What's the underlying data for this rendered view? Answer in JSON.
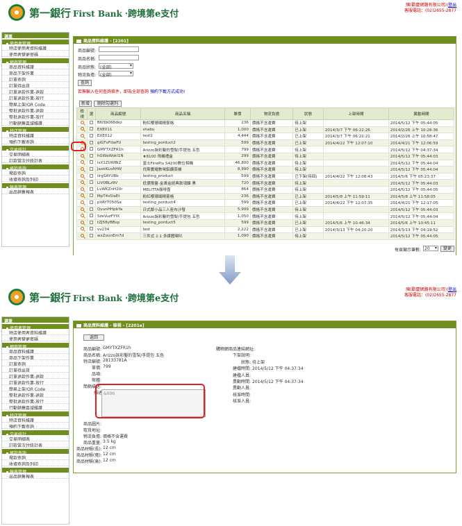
{
  "header": {
    "bank_name": "第一銀行",
    "bank_name_en": "First Bank",
    "service": "‧跨境第e支付",
    "merchant": "陳(歡慶網路有限公司)",
    "logout": "登出",
    "phone": "客服電話：(02)2655-2877"
  },
  "sidebar": {
    "top": "選單",
    "groups": [
      {
        "label": "使用者管理",
        "items": [
          "特店使用者資料維護",
          "使用者變更密碼"
        ]
      },
      {
        "label": "網商管理",
        "items": [
          "商品資料維護",
          "商品下架作業",
          "訂單查詢",
          "訂單待出貨",
          "訂單退款作業-退款",
          "訂單退款作業-放行",
          "簡易上架/QR Code",
          "整批退款作業-退款",
          "整批退款作業-放行",
          "行動銷售區域維護"
        ]
      },
      {
        "label": "特店管理",
        "items": [
          "特店資料維護",
          "預約下載查詢"
        ]
      },
      {
        "label": "交易統計",
        "items": [
          "交易明細表",
          "訂款當次付統計表"
        ]
      },
      {
        "label": "帳款查詢",
        "items": [
          "撥款查詢",
          "收據查詢及列印"
        ]
      },
      {
        "label": "報表管理",
        "items": [
          "出品銷售報表"
        ]
      }
    ]
  },
  "list": {
    "title": "商品資料維護 - [2201]",
    "form": {
      "code_label": "商品編號:",
      "name_label": "商品名稱:",
      "status_label": "商品狀態:",
      "status_value": "(全部)",
      "logistics_label": "物流負擔:",
      "logistics_value": "(全部)",
      "search_btn": "查詢"
    },
    "note": "若無輸入任何查詢條件，即為全部查詢",
    "note_link": "預約下載方式成功!",
    "buttons": {
      "add": "新增",
      "delete": "刪除勾選列"
    },
    "columns": [
      "檢視",
      "選",
      "商品編號",
      "商品名稱",
      "單價",
      "物流負擔",
      "狀態",
      "上架時間",
      "異動時間"
    ],
    "rows": [
      [
        "BN3b068dko",
        "粉紅櫻珊瑚精靈格",
        "236",
        "價格不含運費",
        "待上架",
        "",
        "2014/5/12 下午 05:44:05"
      ],
      [
        "EXE011",
        "shabu",
        "1,000",
        "價格不含運費",
        "已上架",
        "2014/3/7 下午 06:22:26",
        "2014/2/26 上午 10:28:36"
      ],
      [
        "EXE012",
        "test2",
        "4,444",
        "價格不含運費",
        "已上架",
        "2014/3/7 下午 06:22:21",
        "2014/2/26 上午 10:58:47"
      ],
      [
        "giGTvFdwFU",
        "testing_porduct2",
        "599",
        "價格不含運費",
        "已上架",
        "2014/4/22 下午 12:07:10",
        "2014/4/21 下午 12:06:59"
      ],
      [
        "GMYTXZFR1h",
        "Arizzo訴彩鑿的雪梨/手提包 五色",
        "799",
        "價格不含運費",
        "待上架",
        "",
        "2014/5/12 下午 04:37:34"
      ],
      [
        "hGWaWokl1N",
        "★8100 飛機禮盒",
        "299",
        "價格不含運費",
        "待上架",
        "",
        "2014/5/12 下午 05:44:03"
      ],
      [
        "isX1ZUWBiZ",
        "富士FinePix S4200數位相機",
        "46,800",
        "價格不含運費",
        "待上架",
        "",
        "2014/5/12 下午 05:44:04"
      ],
      [
        "JaxkKLoAHW",
        "伐斯實耀數咪鋁鑽菜機",
        "8,990",
        "價格不含運費",
        "待上架",
        "",
        "2014/5/12 下午 05:44:04"
      ],
      [
        "lirgSAYUBb",
        "testing_product",
        "599",
        "價格不含運費",
        "已下架(待回)",
        "2014/4/22 下午 12:08:43",
        "2014/5/6 下午 05:23:37"
      ],
      [
        "LiV0BLz9V",
        "低價限量-金黃金經典款項鍊 黑",
        "720",
        "價格不含運費",
        "待上架",
        "",
        "2014/5/12 下午 05:44:03"
      ],
      [
        "LvWKZnH20r",
        "MELITTA咖啡壺",
        "864",
        "價格不含運費",
        "待上架",
        "",
        "2014/5/12 下午 05:44:05"
      ],
      [
        "MpT4s5IaEt",
        "粉紅櫻珊瑚精靈格",
        "236",
        "價格不含運費",
        "已上架",
        "2014/5/8 上午 11:59:11",
        "2014/5/8 上午 11:58:05"
      ],
      [
        "pVAYT050Sa",
        "testing_porduct4",
        "599",
        "價格不含運費",
        "已上架",
        "2014/4/22 下午 12:07:35",
        "2014/4/21 下午 12:17:05"
      ],
      [
        "QvunHHpbYa",
        "日式鄰小品三人座布沙發",
        "5,999",
        "價格不含運費",
        "待上架",
        "",
        "2014/5/12 下午 05:44:03"
      ],
      [
        "SzeVuzFYfX",
        "Arizzo訴彩鑿的雪梨/手提包 五色",
        "1,050",
        "價格不含運費",
        "待上架",
        "",
        "2014/5/12 下午 05:44:04"
      ],
      [
        "tZJ58yBBsp",
        "testing_porduct5",
        "599",
        "價格不含運費",
        "已上架",
        "2014/5/6 上午 10:46:34",
        "2014/5/6 上午 10:45:11"
      ],
      [
        "vv234",
        "test",
        "2,222",
        "價格不含運費",
        "已上架",
        "2014/3/13 下午 04:20:20",
        "2014/3/13 下午 04:19:52"
      ],
      [
        "wxZounEm7d",
        "三件式 2.1 多媒體喇叭",
        "1,090",
        "價格不含運費",
        "待上架",
        "",
        "2014/5/12 下午 05:44:05"
      ]
    ],
    "page_size_label": "每頁顯示筆數:",
    "page_size": "20",
    "page_btn": "變更"
  },
  "detail": {
    "title": "商品資料維護 - 檢視 - [2201e]",
    "back_btn": "返回",
    "left": [
      [
        "商品編號:",
        "GMYTXZFR1h"
      ],
      [
        "商品名稱:",
        "Arizzo訴彩鑿的雪梨/手提包 五色"
      ],
      [
        "特店編號:",
        "28133781A"
      ],
      [
        "單價:",
        "799"
      ],
      [
        "品項:",
        ""
      ],
      [
        "幣種:",
        ""
      ],
      [
        "簡稱描述:",
        ""
      ]
    ],
    "desc_label": "描述:",
    "desc_value": "&006",
    "left2": [
      [
        "商品圖片:",
        ""
      ],
      [
        "取貨地址:",
        ""
      ],
      [
        "物流負擔:",
        "價格不含運費"
      ],
      [
        "商品重量:",
        "3.5 kg"
      ],
      [
        "商品材積(長):",
        "12 cm"
      ],
      [
        "商品材積(寬):",
        "12 cm"
      ],
      [
        "商品材積(高):",
        "12 cm"
      ]
    ],
    "right": [
      [
        "購物網商品連結網址:",
        ""
      ],
      [
        "下架說明:",
        ""
      ],
      [
        "狀態:",
        "待上架"
      ],
      [
        "建檔時間:",
        "2014/5/12 下午 04:37:34"
      ],
      [
        "建檔人員:",
        ""
      ],
      [
        "異動時間:",
        "2014/5/12 下午 04:37:34"
      ],
      [
        "異動人員:",
        ""
      ],
      [
        "核准時間:",
        ""
      ],
      [
        "核准人員:",
        ""
      ]
    ]
  }
}
